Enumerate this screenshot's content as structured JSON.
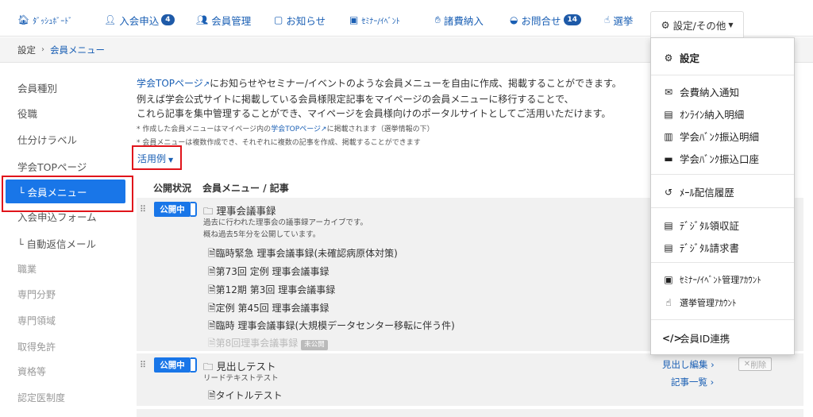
{
  "nav": {
    "dashboard": "ﾀﾞｯｼｭﾎﾞｰﾄﾞ",
    "applications": "入会申込",
    "applications_badge": "4",
    "members": "会員管理",
    "notices": "お知らせ",
    "seminars": "ｾﾐﾅｰ/ｲﾍﾞﾝﾄ",
    "fees": "諸費納入",
    "inquiries": "お問合せ",
    "inquiries_badge": "14",
    "election": "選挙",
    "settings": "設定/その他"
  },
  "breadcrumb": {
    "root": "設定",
    "sep": "›",
    "current": "会員メニュー"
  },
  "sidebar": {
    "items": [
      "会員種別",
      "役職",
      "仕分けラベル",
      "学会TOPページ",
      "└ 会員メニュー",
      "入会申込フォーム",
      "└ 自動返信メール",
      "職業",
      "専門分野",
      "専門領域",
      "取得免許",
      "資格等",
      "認定医制度"
    ]
  },
  "intro": {
    "link": "学会TOPページ",
    "line1_rest": "にお知らせやセミナー/イベントのような会員メニューを自由に作成、掲載することができます。",
    "line2": "例えば学会公式サイトに掲載している会員様限定記事をマイページの会員メニューに移行することで、",
    "line3": "これら記事を集中管理することができ、マイページを会員様向けのポータルサイトとしてご活用いただけます。"
  },
  "notes": {
    "note1_pre": "* 作成した会員メニューはマイページ内の",
    "note1_link": "学会TOPページ",
    "note1_post": "に掲載されます（選挙情報の下）",
    "note2": "* 会員メニューは複数作成でき、それぞれに複数の記事を作成、掲載することができます"
  },
  "usage_label": "活用例",
  "table": {
    "col_status": "公開状況",
    "col_menu": "会員メニュー / 記事"
  },
  "rows": [
    {
      "status": "公開中",
      "title": "理事会議事録",
      "desc1": "過去に行われた理事会の議事録アーカイブです。",
      "desc2": "概ね過去5年分を公開しています。",
      "articles": [
        "臨時緊急 理事会議事録(未確認病原体対策)",
        "第73回 定例 理事会議事録",
        "第12期 第3回 理事会議事録",
        "定例 第45回 理事会議事録",
        "臨時 理事会議事録(大規模データセンター移転に伴う件)"
      ],
      "draft_article": "第8回理事会議事録",
      "draft_tag": "未公開"
    },
    {
      "status": "公開中",
      "title": "見出しテスト",
      "desc1": "リードテキストテスト",
      "articles": [
        "タイトルテスト"
      ],
      "edit": "見出し編集 ›",
      "list": "記事一覧 ›",
      "delete": "削除"
    }
  ],
  "dropdown": {
    "settings": "設定",
    "fee_notice": "会費納入通知",
    "online_detail": "ｵﾝﾗｲﾝ納入明細",
    "bank_detail": "学会ﾊﾞﾝｸ振込明細",
    "bank_account": "学会ﾊﾞﾝｸ振込口座",
    "mail_history": "ﾒｰﾙ配信履歴",
    "receipt": "ﾃﾞｼﾞﾀﾙ領収証",
    "invoice": "ﾃﾞｼﾞﾀﾙ請求書",
    "seminar_account": "ｾﾐﾅｰ/ｲﾍﾞﾝﾄ管理ｱｶｳﾝﾄ",
    "election_account": "選挙管理ｱｶｳﾝﾄ",
    "member_id": "会員ID連携"
  },
  "colors": {
    "primary": "#1976e8",
    "link": "#1a5fb4",
    "highlight": "#e0141b"
  }
}
